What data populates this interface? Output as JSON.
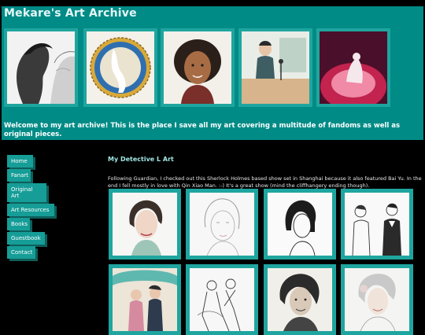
{
  "site": {
    "title": "Mekare's Art Archive",
    "welcome": "Welcome to my art archive! This is the place I save all my art covering a multitude of fandoms as well as original pieces."
  },
  "nav": {
    "items": [
      {
        "label": "Home"
      },
      {
        "label": "Fanart"
      },
      {
        "label": "Original Art"
      },
      {
        "label": "Art Resources"
      },
      {
        "label": "Books"
      },
      {
        "label": "Guestbook"
      },
      {
        "label": "Contact"
      }
    ]
  },
  "post": {
    "title": "My Detective L Art",
    "body": "Following Guardian, I checked out this Sherlock Holmes based show set in Shanghai because it also featured Bai Yu. In the end I fell mostly in love with Qin Xiao Man. :-) It's a great show (mind the cliffhangery ending though)."
  },
  "colors": {
    "header_bg": "#008b86",
    "thumb_frame": "#1fa59f",
    "nav_bg": "#169d97",
    "post_title": "#9fe7e3",
    "page_bg": "#000000"
  }
}
